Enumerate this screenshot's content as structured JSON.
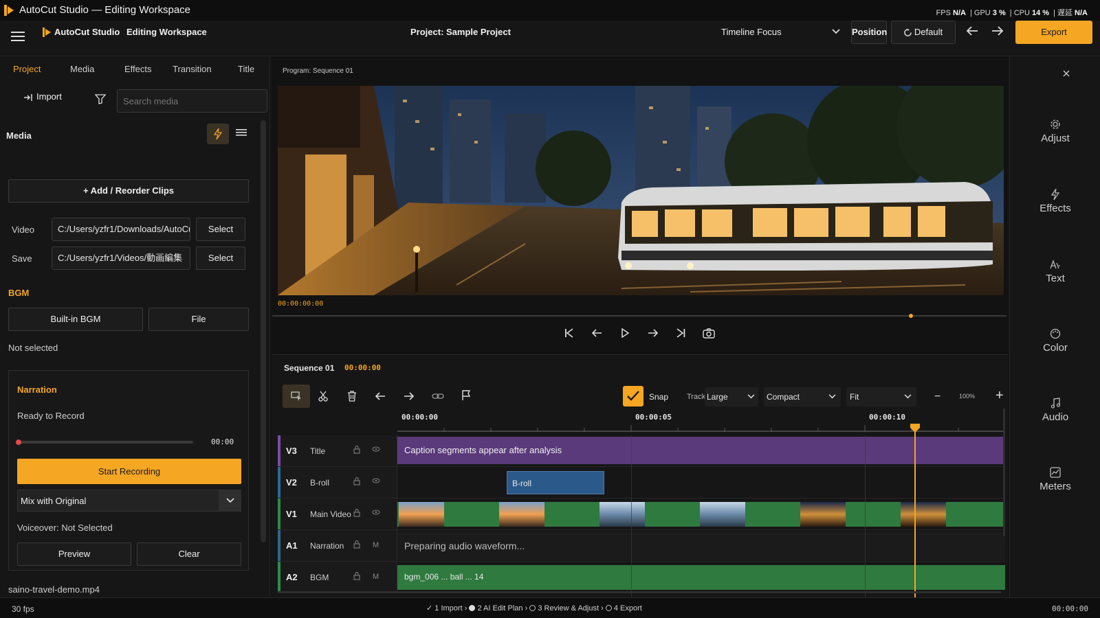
{
  "titlebar": {
    "title": "AutoCut Studio — Editing Workspace",
    "fps_label": "FPS",
    "fps_value": "N/A",
    "gpu_label": "GPU",
    "gpu_value": "3 %",
    "cpu_label": "CPU",
    "cpu_value": "14 %",
    "delay_label": "遅延",
    "delay_value": "N/A"
  },
  "toolbar": {
    "app_name": "AutoCut Studio",
    "workspace": "Editing Workspace",
    "project": "Project: Sample Project",
    "layout_select": "Timeline Focus",
    "position": "Position",
    "default": "Default",
    "export": "Export"
  },
  "left": {
    "tabs": [
      "Project",
      "Media",
      "Effects",
      "Transition",
      "Title"
    ],
    "import_label": "Import",
    "search_placeholder": "Search media",
    "media_heading": "Media",
    "add_reorder": "+ Add / Reorder Clips",
    "video_label": "Video",
    "video_path": "C:/Users/yzfr1/Downloads/AutoCu",
    "save_label": "Save",
    "save_path": "C:/Users/yzfr1/Videos/動画編集",
    "select_label": "Select",
    "bgm_heading": "BGM",
    "builtin_bgm": "Built-in BGM",
    "file": "File",
    "bgm_status": "Not selected",
    "narration": {
      "heading": "Narration",
      "status": "Ready to Record",
      "time": "00:00",
      "start_recording": "Start Recording",
      "mix_mode": "Mix with Original",
      "voiceover": "Voiceover: Not Selected",
      "preview": "Preview",
      "clear": "Clear"
    },
    "filename": "saino-travel-demo.mp4"
  },
  "program": {
    "label": "Program: Sequence 01",
    "timecode": "00:00:00:00",
    "scrub_position_fraction": 0.87
  },
  "timeline": {
    "sequence": "Sequence 01",
    "timecode": "00:00:00",
    "snap": "Snap",
    "track_label": "Track",
    "track_size": "Large",
    "density": "Compact",
    "zoom_mode": "Fit",
    "zoom_percent": "100%",
    "ruler": [
      "00:00:00",
      "00:00:05",
      "00:00:10"
    ],
    "tracks": [
      {
        "id": "V3",
        "name": "Title",
        "toggle": "eye"
      },
      {
        "id": "V2",
        "name": "B-roll",
        "toggle": "eye"
      },
      {
        "id": "V1",
        "name": "Main Video",
        "toggle": "eye"
      },
      {
        "id": "A1",
        "name": "Narration",
        "toggle": "M"
      },
      {
        "id": "A2",
        "name": "BGM",
        "toggle": "M"
      }
    ],
    "caption_text": "Caption segments appear after analysis",
    "broll_clip": "B-roll",
    "waveform_text": "Preparing audio waveform...",
    "bgm_clip_text": "bgm_006 ... ball ... 14"
  },
  "rail": [
    "Adjust",
    "Effects",
    "Text",
    "Color",
    "Audio",
    "Meters"
  ],
  "status": {
    "fps": "30 fps",
    "steps": [
      "1 Import",
      "2 AI Edit Plan",
      "3 Review & Adjust",
      "4 Export"
    ],
    "timecode": "00:00:00"
  },
  "colors": {
    "accent": "#f5a623",
    "caption_track": "#5a3a7a",
    "video_track": "#2f7a3f",
    "broll_clip": "#2b5a8a"
  }
}
